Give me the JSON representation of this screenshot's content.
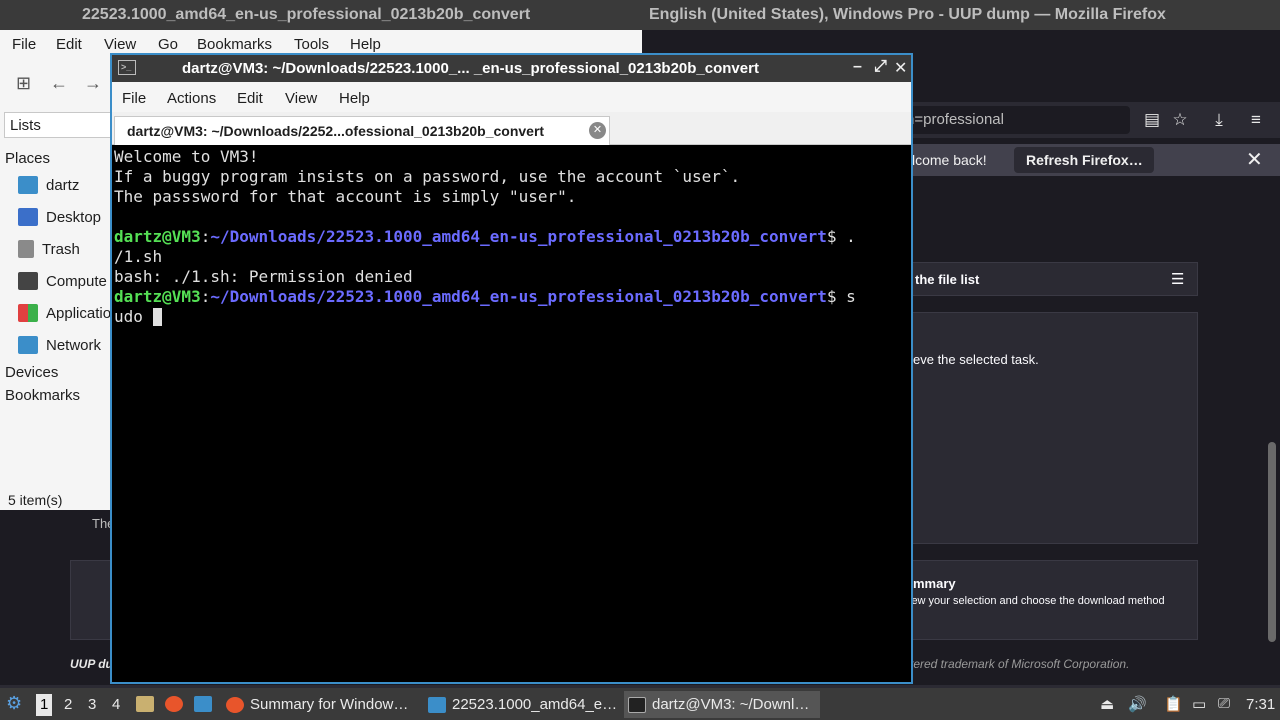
{
  "topbar": {
    "left_title": "22523.1000_amd64_en-us_professional_0213b20b_convert",
    "right_title": "English (United States), Windows Pro - UUP dump — Mozilla Firefox"
  },
  "firefox": {
    "url_fragment": "n=professional",
    "notice_message": "lcome back!",
    "notice_button": "Refresh Firefox…",
    "card1_title": "the file list",
    "card2_text": "eve the selected task.",
    "card3_title": "mmary",
    "card3_text": "iew your selection and choose the download method",
    "trademark": "tered trademark of Microsoft Corporation.",
    "left_text": "The",
    "uup_text": "UUP du"
  },
  "file_manager": {
    "menu": [
      "File",
      "Edit",
      "View",
      "Go",
      "Bookmarks",
      "Tools",
      "Help"
    ],
    "lists_label": "Lists",
    "places_header": "Places",
    "places": [
      {
        "label": "dartz",
        "color": "#3b8ec9"
      },
      {
        "label": "Desktop",
        "color": "#3b6fc9"
      },
      {
        "label": "Trash",
        "color": "#8a8a8a"
      },
      {
        "label": "Compute",
        "color": "#444444"
      },
      {
        "label": "Applicatio",
        "color": "#e0a020"
      },
      {
        "label": "Network",
        "color": "#3b8ec9"
      }
    ],
    "devices_header": "Devices",
    "bookmarks_header": "Bookmarks",
    "status": "5 item(s)"
  },
  "terminal": {
    "title": "dartz@VM3: ~/Downloads/22523.1000_... _en-us_professional_0213b20b_convert",
    "menu": [
      "File",
      "Actions",
      "Edit",
      "View",
      "Help"
    ],
    "tab_label": "dartz@VM3: ~/Downloads/2252...ofessional_0213b20b_convert",
    "welcome": [
      "Welcome to VM3!",
      "If a buggy program insists on a password, use the account `user`.",
      "The passsword for that account is simply \"user\"."
    ],
    "prompt_user": "dartz@VM3",
    "prompt_path": "~/Downloads/22523.1000_amd64_en-us_professional_0213b20b_convert",
    "cmd1_a": " .",
    "cmd1_b": "/1.sh",
    "error": "bash: ./1.sh: Permission denied",
    "cmd2_a": " s",
    "cmd2_b": "udo "
  },
  "taskbar": {
    "workspaces": [
      "1",
      "2",
      "3",
      "4"
    ],
    "tasks": [
      {
        "label": "Summary for Window…",
        "icon_color": "#e8552b"
      },
      {
        "label": "22523.1000_amd64_e…",
        "icon_color": "#3b8ec9"
      },
      {
        "label": "dartz@VM3: ~/Downl…",
        "icon_color": "#222222"
      }
    ],
    "clock": "7:31"
  }
}
